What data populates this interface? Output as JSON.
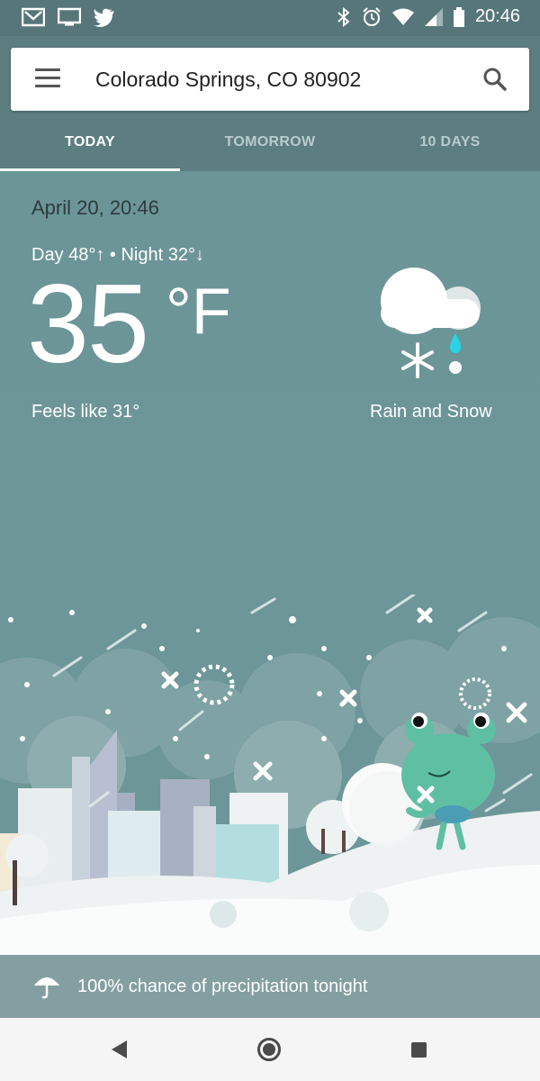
{
  "status_bar": {
    "left_icons": [
      "gmail-icon",
      "cast-display-icon",
      "twitter-icon"
    ],
    "right_icons": [
      "bluetooth-icon",
      "alarm-icon",
      "wifi-icon",
      "signal-icon",
      "battery-icon"
    ],
    "time": "20:46"
  },
  "search": {
    "location": "Colorado Springs, CO 80902"
  },
  "tabs": [
    {
      "label": "TODAY",
      "active": true
    },
    {
      "label": "TOMORROW",
      "active": false
    },
    {
      "label": "10 DAYS",
      "active": false
    }
  ],
  "weather": {
    "date_time": "April 20, 20:46",
    "day_night": "Day 48°↑ • Night 32°↓",
    "temperature": "35",
    "unit": "°F",
    "feels_like": "Feels like 31°",
    "condition": "Rain and Snow",
    "condition_icon": "rain-snow-cloud-icon"
  },
  "precipitation": {
    "text": "100% chance of precipitation tonight",
    "icon": "umbrella-icon"
  },
  "nav_bar": {
    "icons": [
      "back-icon",
      "home-icon",
      "recents-icon"
    ]
  },
  "colors": {
    "status_bar": "#56767a",
    "header": "#5d7e81",
    "scene": "#6e979a",
    "precip_bar": "#849fa1",
    "nav_bar": "#f5f5f5",
    "frog": "#5fbfa3"
  }
}
